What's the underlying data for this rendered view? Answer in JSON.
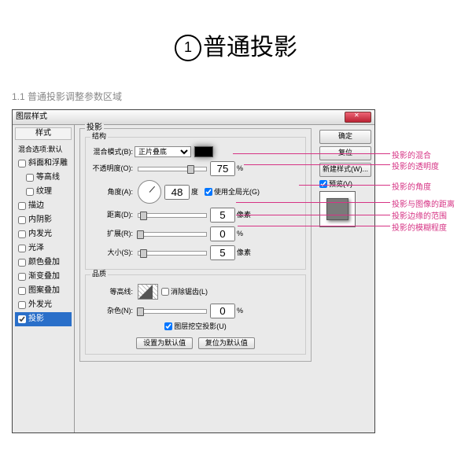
{
  "header": {
    "num": "1",
    "title": "普通投影"
  },
  "subtitle": "1.1 普通投影调整参数区域",
  "dialog_title": "图层样式",
  "sidebar": {
    "head": "样式",
    "default_item": "混合选项:默认",
    "items": [
      {
        "label": "斜面和浮雕",
        "checked": false
      },
      {
        "label": "等高线",
        "checked": false,
        "indent": true
      },
      {
        "label": "纹理",
        "checked": false,
        "indent": true
      },
      {
        "label": "描边",
        "checked": false
      },
      {
        "label": "内阴影",
        "checked": false
      },
      {
        "label": "内发光",
        "checked": false
      },
      {
        "label": "光泽",
        "checked": false
      },
      {
        "label": "颜色叠加",
        "checked": false
      },
      {
        "label": "渐变叠加",
        "checked": false
      },
      {
        "label": "图案叠加",
        "checked": false
      },
      {
        "label": "外发光",
        "checked": false
      },
      {
        "label": "投影",
        "checked": true,
        "selected": true
      }
    ]
  },
  "panel": {
    "title": "投影",
    "structure_title": "结构",
    "blend_label": "混合模式(B):",
    "blend_value": "正片叠底",
    "opacity_label": "不透明度(O):",
    "opacity_value": "75",
    "opacity_unit": "%",
    "angle_label": "角度(A):",
    "angle_value": "48",
    "angle_unit": "度",
    "global_light": "使用全局光(G)",
    "distance_label": "距离(D):",
    "distance_value": "5",
    "distance_unit": "像素",
    "spread_label": "扩展(R):",
    "spread_value": "0",
    "spread_unit": "%",
    "size_label": "大小(S):",
    "size_value": "5",
    "size_unit": "像素",
    "quality_title": "品质",
    "contour_label": "等高线:",
    "antialias": "消除锯齿(L)",
    "noise_label": "杂色(N):",
    "noise_value": "0",
    "noise_unit": "%",
    "knockout": "图层挖空投影(U)",
    "make_default": "设置为默认值",
    "reset_default": "复位为默认值"
  },
  "buttons": {
    "ok": "确定",
    "cancel": "复位",
    "new_style": "新建样式(W)...",
    "preview": "预览(V)"
  },
  "annotations": {
    "a1": "投影的混合",
    "a2": "投影的透明度",
    "a3": "投影的角度",
    "a4": "投影与图像的距离",
    "a5": "投影边缘的范围",
    "a6": "投影的模糊程度"
  }
}
